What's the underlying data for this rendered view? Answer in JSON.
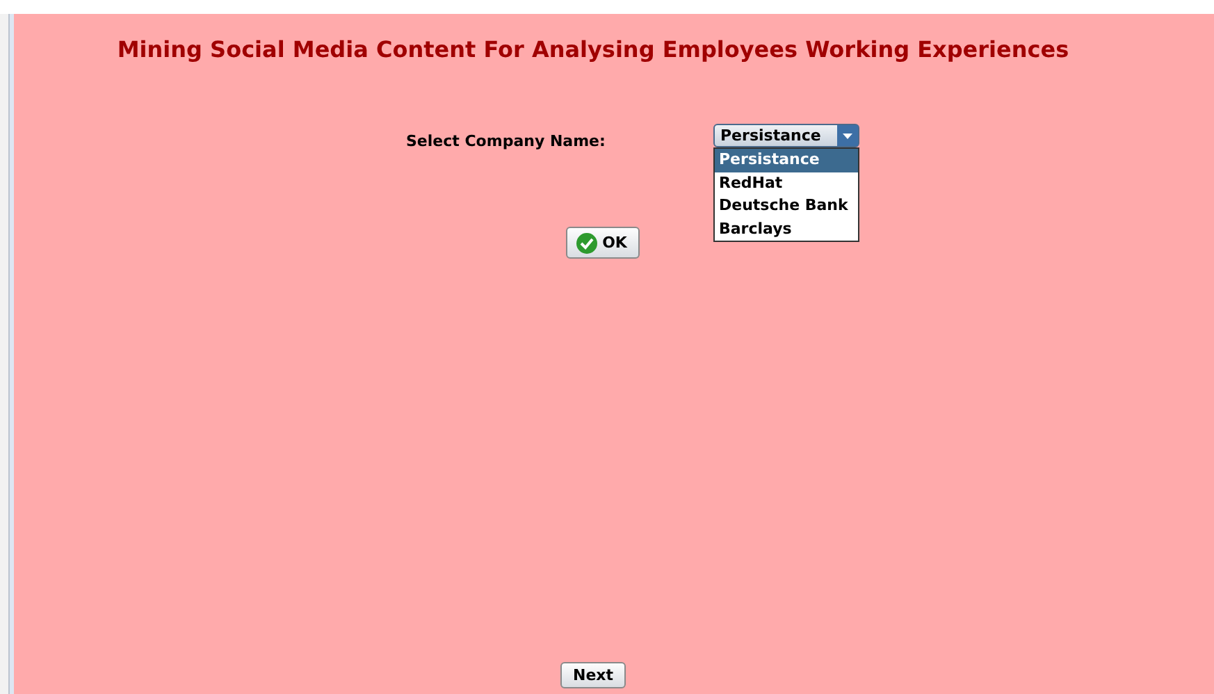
{
  "title": "Mining Social Media Content For Analysing Employees Working Experiences",
  "company": {
    "label": "Select Company Name:",
    "value": "Persistance",
    "expanded": true,
    "options": [
      {
        "label": "Persistance",
        "selected": true
      },
      {
        "label": "RedHat",
        "selected": false
      },
      {
        "label": "Deutsche Bank",
        "selected": false
      },
      {
        "label": "Barclays",
        "selected": false
      }
    ]
  },
  "ok_button": "OK",
  "next_button": "Next"
}
